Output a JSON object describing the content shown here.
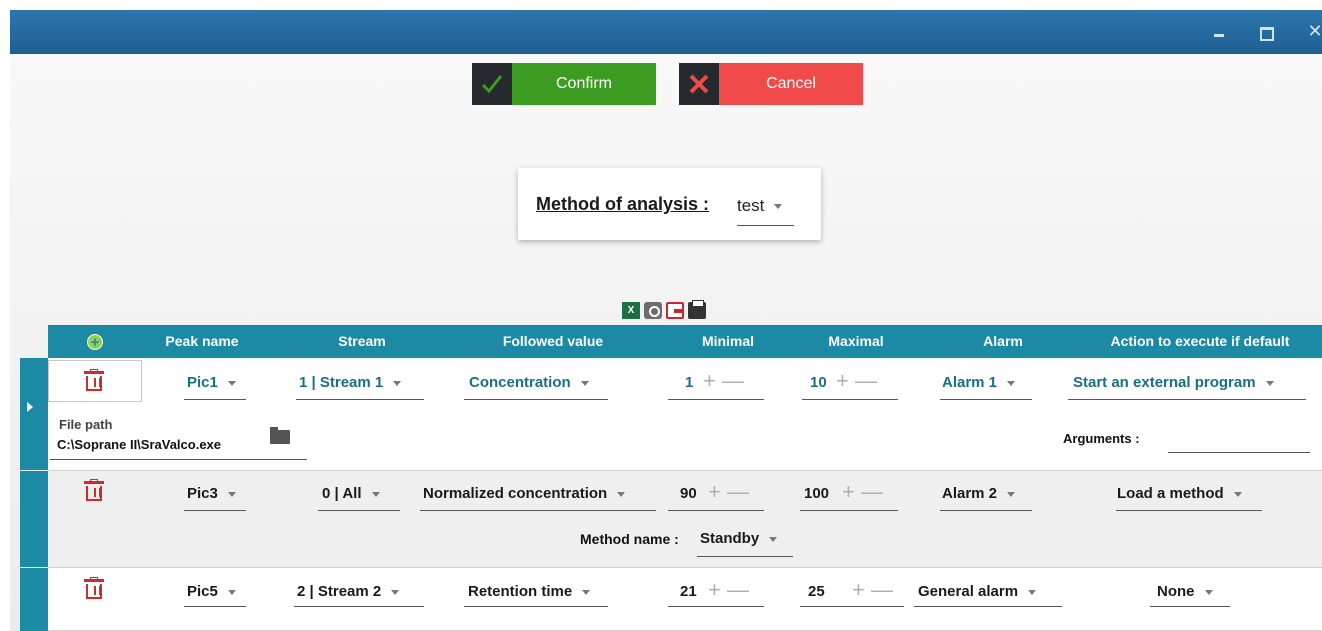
{
  "window": {
    "minimize": "‒",
    "maximize": "",
    "close": "✕"
  },
  "actions": {
    "confirm_label": "Confirm",
    "cancel_label": "Cancel"
  },
  "method": {
    "label": "Method of analysis :",
    "value": "test"
  },
  "toolbar": {
    "excel_icon": "excel-export-icon",
    "camera_icon": "camera-icon",
    "export_icon": "export-icon",
    "print_icon": "print-icon",
    "excel_glyph": "X"
  },
  "table": {
    "headers": {
      "peak_name": "Peak name",
      "stream": "Stream",
      "followed_value": "Followed value",
      "minimal": "Minimal",
      "maximal": "Maximal",
      "alarm": "Alarm",
      "action": "Action to execute if default"
    },
    "add_icon_glyph": "+",
    "plus_minus": "+ —",
    "rows": [
      {
        "peak": "Pic1",
        "stream": "1 | Stream 1",
        "followed": "Concentration",
        "min": "1",
        "max": "10",
        "alarm": "Alarm 1",
        "action": "Start an external program",
        "detail": {
          "file_path_label": "File path",
          "file_path_value": "C:\\Soprane II\\SraValco.exe",
          "arguments_label": "Arguments :",
          "arguments_value": ""
        }
      },
      {
        "peak": "Pic3",
        "stream": "0 | All",
        "followed": "Normalized concentration",
        "min": "90",
        "max": "100",
        "alarm": "Alarm 2",
        "action": "Load a method",
        "detail": {
          "method_name_label": "Method name :",
          "method_name_value": "Standby"
        }
      },
      {
        "peak": "Pic5",
        "stream": "2 | Stream 2",
        "followed": "Retention time",
        "min": "21",
        "max": "25",
        "alarm": "General alarm",
        "action": "None"
      }
    ]
  }
}
